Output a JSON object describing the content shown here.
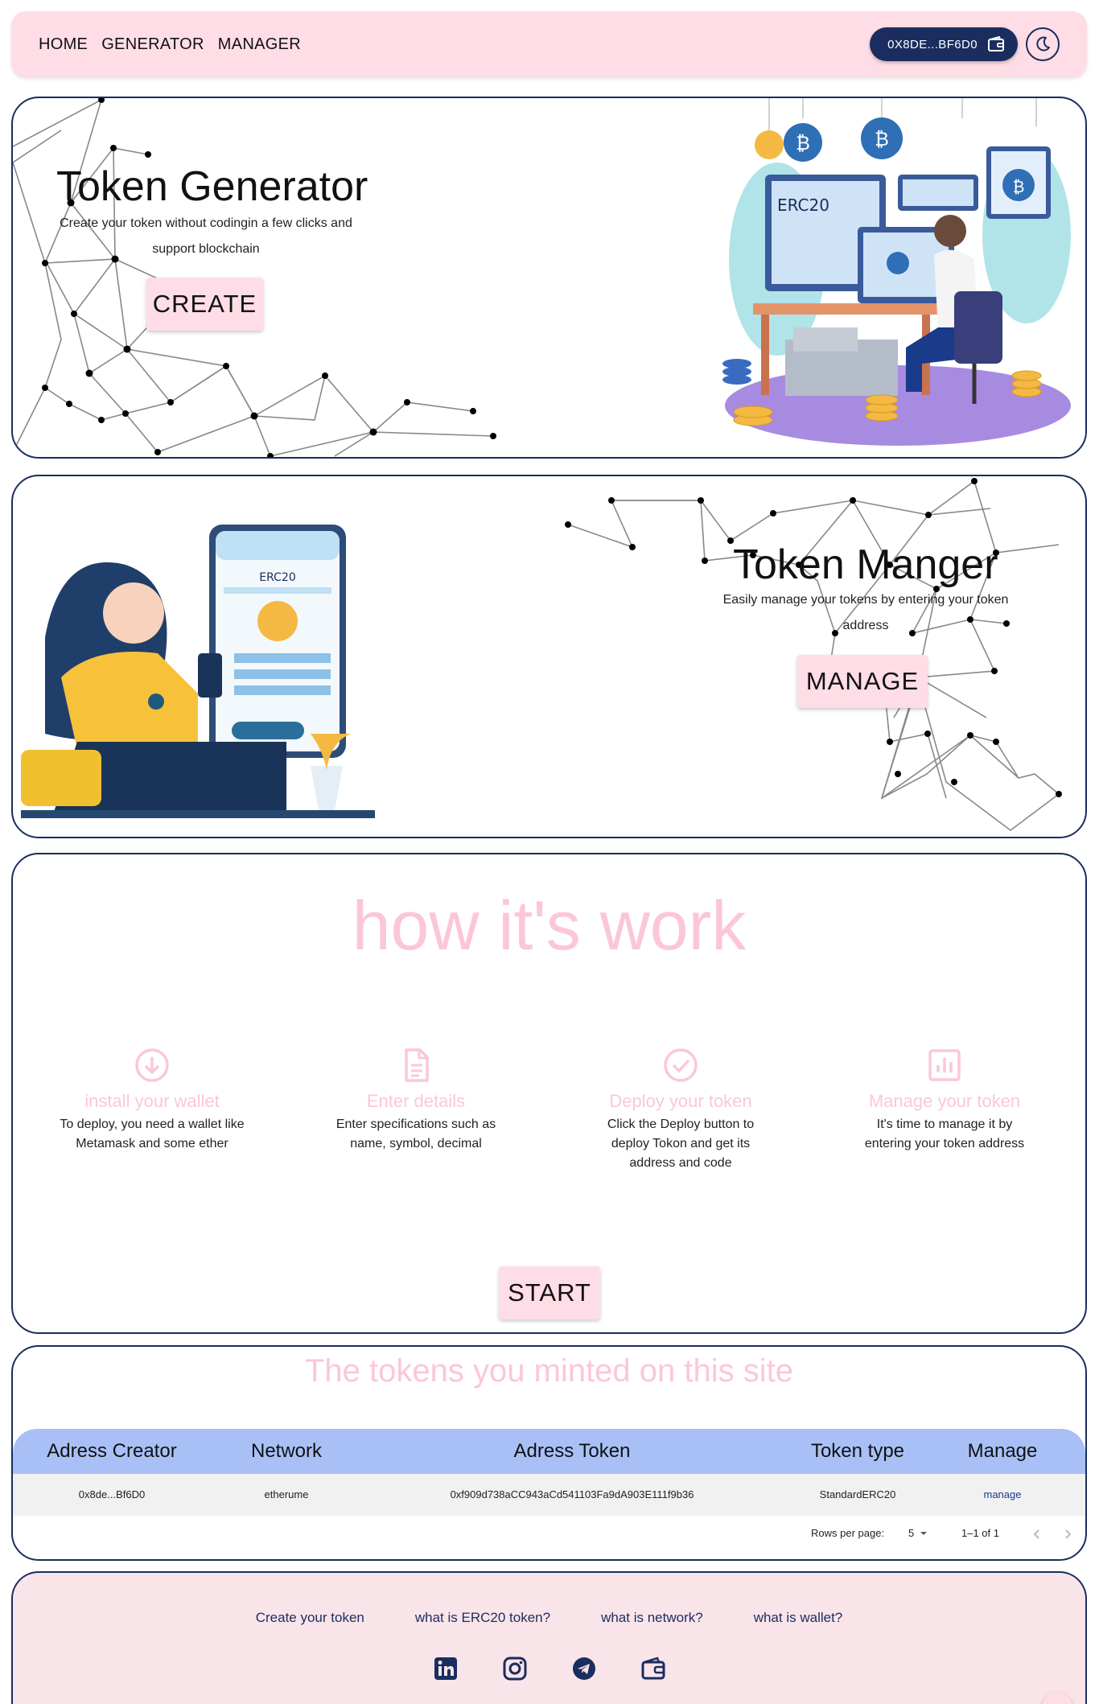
{
  "nav": {
    "links": [
      "HOME",
      "GENERATOR",
      "MANAGER"
    ],
    "wallet_label": "0X8DE...BF6D0",
    "wallet_icon": "wallet-icon",
    "theme_icon": "moon-icon"
  },
  "generator": {
    "title": "Token Generator",
    "subtitle": "Create your token without codingin a few clicks and support blockchain",
    "button": "CREATE",
    "illustration_text": "ERC20"
  },
  "manager": {
    "title": "Token Manger",
    "subtitle": "Easily manage your tokens by entering your token address",
    "button": "MANAGE",
    "illustration_text": "ERC20"
  },
  "how": {
    "title": "how it's work",
    "steps": [
      {
        "icon": "download-circle-icon",
        "title": "install your wallet",
        "desc": "To deploy, you need a wallet like Metamask and some ether"
      },
      {
        "icon": "document-icon",
        "title": "Enter details",
        "desc": "Enter specifications such as name, symbol, decimal"
      },
      {
        "icon": "check-circle-icon",
        "title": "Deploy your token",
        "desc": "Click the Deploy button to deploy Tokon and get its address and code"
      },
      {
        "icon": "bar-chart-icon",
        "title": "Manage your token",
        "desc": "It's time to manage it by entering your token address"
      }
    ],
    "button": "START"
  },
  "tokens": {
    "title": "The tokens you minted on this site",
    "columns": [
      "Adress Creator",
      "Network",
      "Adress Token",
      "Token type",
      "Manage"
    ],
    "rows": [
      [
        "0x8de...Bf6D0",
        "etherume",
        "0xf909d738aCC943aCd541103Fa9dA903E111f9b36",
        "StandardERC20",
        "manage"
      ]
    ],
    "rows_per_page_label": "Rows per page:",
    "rows_per_page_value": "5",
    "range": "1–1 of 1"
  },
  "footer": {
    "links": [
      "Create your token",
      "what is ERC20 token?",
      "what is network?",
      "what is wallet?"
    ],
    "icons": [
      "linkedin-icon",
      "instagram-icon",
      "telegram-icon",
      "wallet-icon"
    ]
  },
  "colors": {
    "navy": "#1a2d5e",
    "pink": "#ffdde6",
    "pink_text": "#fbc7d6",
    "table_header": "#a9c0f7"
  }
}
